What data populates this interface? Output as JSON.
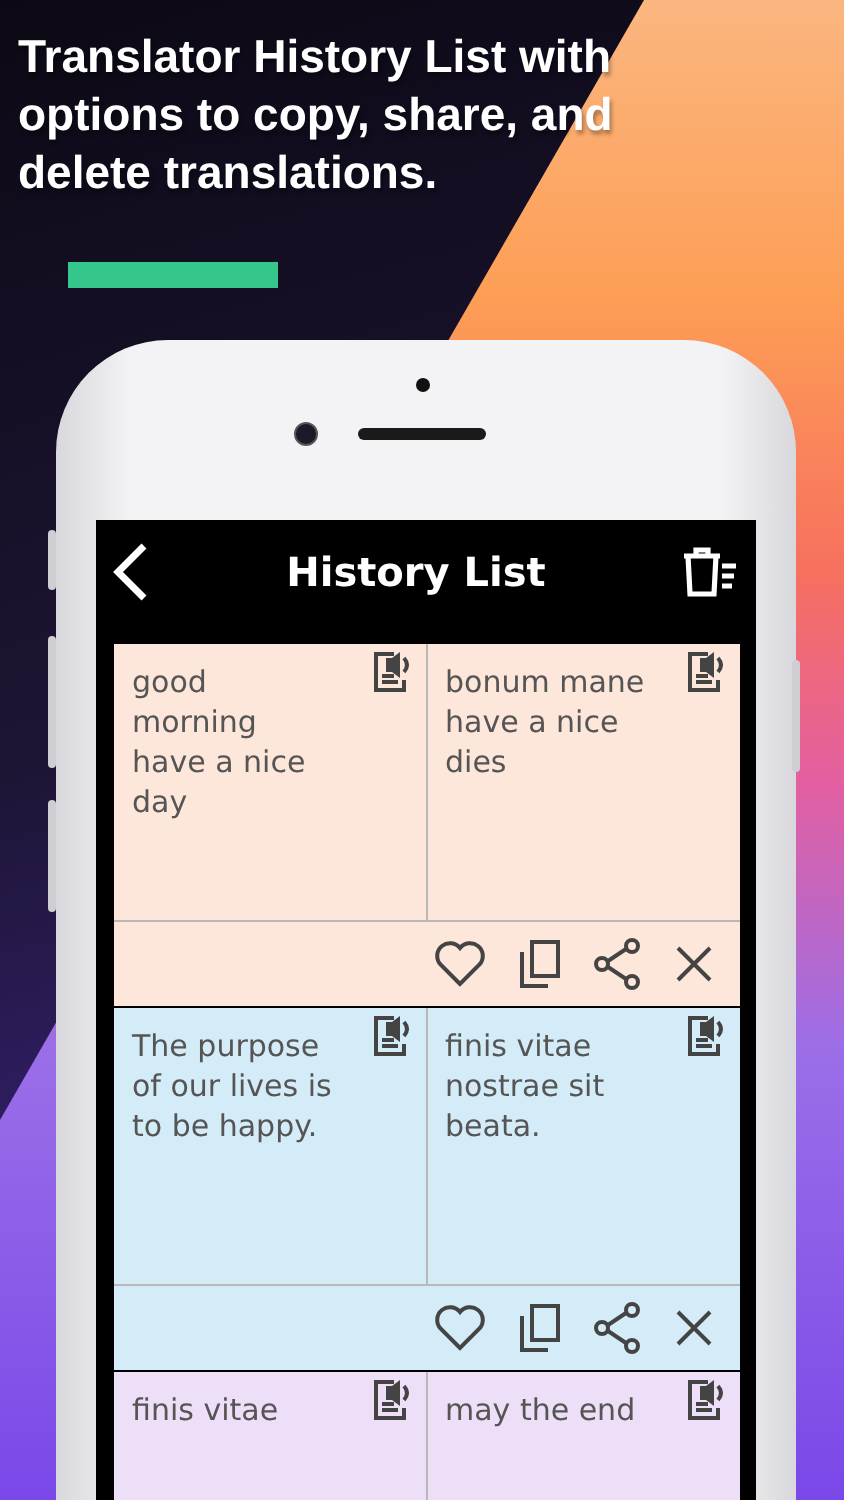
{
  "headline": "Translator History List with options to copy, share, and delete translations.",
  "header": {
    "title": "History List"
  },
  "entries": [
    {
      "source": "good morning have a nice day",
      "translation": "bonum mane have a nice dies",
      "color": "#fde6da"
    },
    {
      "source": "The purpose of our lives is to be happy.",
      "translation": "finis vitae nostrae sit beata.",
      "color": "#d3ecf8"
    },
    {
      "source": "finis vitae",
      "translation": "may the end",
      "color": "#eedff8"
    }
  ]
}
